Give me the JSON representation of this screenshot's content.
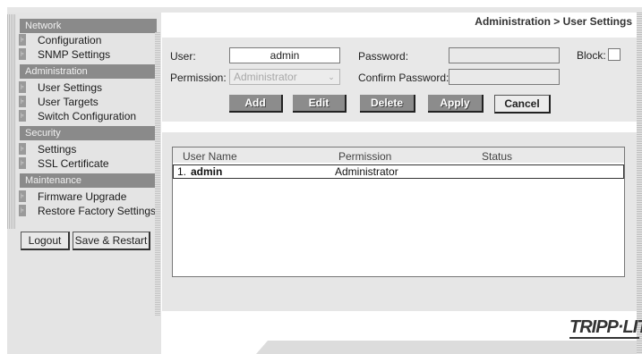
{
  "nav": {
    "sections": [
      {
        "header": "Network",
        "items": [
          "Configuration",
          "SNMP Settings"
        ]
      },
      {
        "header": "Administration",
        "items": [
          "User Settings",
          "User Targets",
          "Switch Configuration"
        ]
      },
      {
        "header": "Security",
        "items": [
          "Settings",
          "SSL Certificate"
        ]
      },
      {
        "header": "Maintenance",
        "items": [
          "Firmware Upgrade",
          "Restore Factory Settings"
        ]
      }
    ],
    "logout_label": "Logout",
    "save_restart_label": "Save & Restart"
  },
  "page_title": "Administration > User Settings",
  "form": {
    "user_label": "User:",
    "user_value": "admin",
    "password_label": "Password:",
    "password_value": "",
    "block_label": "Block:",
    "block_checked": false,
    "permission_label": "Permission:",
    "permission_value": "Administrator",
    "confirm_label": "Confirm Password:",
    "confirm_value": ""
  },
  "buttons": {
    "add": "Add",
    "edit": "Edit",
    "delete": "Delete",
    "apply": "Apply",
    "cancel": "Cancel"
  },
  "table": {
    "columns": [
      "User Name",
      "Permission",
      "Status"
    ],
    "rows": [
      {
        "index": "1.",
        "user": "admin",
        "permission": "Administrator",
        "status": ""
      }
    ]
  },
  "logo_text": "TRIPP·LITE"
}
